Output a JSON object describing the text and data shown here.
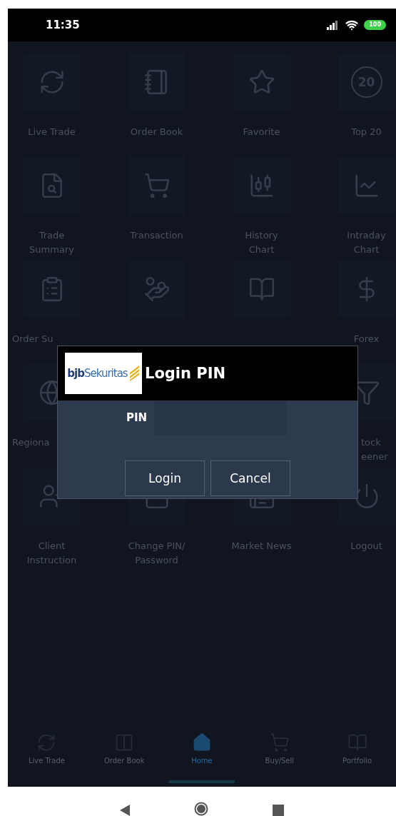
{
  "status_bar": {
    "time": "11:35",
    "battery": "100"
  },
  "menu": [
    {
      "kind": "labeled",
      "label": "Live Trade"
    },
    {
      "kind": "labeled",
      "label": "Order Book"
    },
    {
      "kind": "labeled",
      "label": "Favorite"
    },
    {
      "kind": "labeled",
      "label": "Top 20",
      "icon_text": "20"
    },
    {
      "kind": "labeled",
      "label": "Trade Summary"
    },
    {
      "kind": "labeled",
      "label": "Transaction"
    },
    {
      "kind": "labeled",
      "label": "History Chart"
    },
    {
      "kind": "labeled",
      "label": "Intraday Chart"
    },
    {
      "kind": "labeled",
      "label": "Order Su"
    },
    {
      "kind": "icon_only"
    },
    {
      "kind": "icon_only"
    },
    {
      "kind": "labeled",
      "label": "Forex"
    },
    {
      "kind": "labeled",
      "label": "Regiona"
    },
    {
      "kind": "labeled",
      "label": "tock eener"
    },
    {
      "kind": "labeled",
      "label": "Client Instruction"
    },
    {
      "kind": "labeled",
      "label": "Change PIN/ Password"
    },
    {
      "kind": "labeled",
      "label": "Market News"
    },
    {
      "kind": "labeled",
      "label": "Logout"
    }
  ],
  "dialog": {
    "logo": "**bjb**Sekuritas",
    "title": "Login PIN",
    "field_label": "PIN",
    "buttons": [
      "Login",
      "Cancel"
    ]
  },
  "bottom_nav": [
    {
      "label": "Live Trade",
      "selected": false
    },
    {
      "label": "Order Book",
      "selected": false
    },
    {
      "label": "Home",
      "selected": true
    },
    {
      "label": "Buy/Sell",
      "selected": false
    },
    {
      "label": "Portfolio",
      "selected": false
    }
  ]
}
